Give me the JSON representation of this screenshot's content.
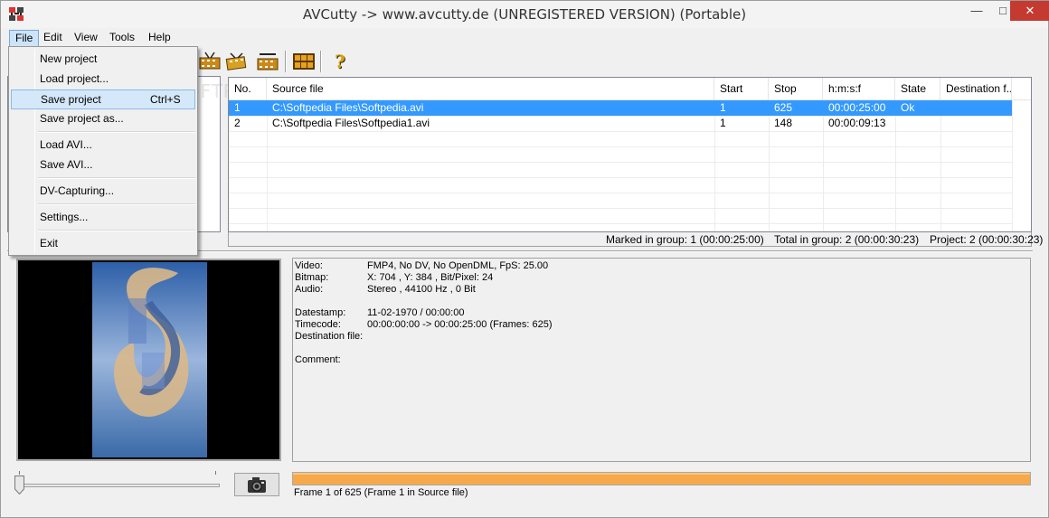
{
  "window": {
    "title": "AVCutty -> www.avcutty.de (UNREGISTERED VERSION) (Portable)",
    "minimize_glyph": "—",
    "maximize_glyph": "□",
    "close_glyph": "✕"
  },
  "menubar": {
    "items": [
      "File",
      "Edit",
      "View",
      "Tools",
      "Help"
    ]
  },
  "file_menu": {
    "items": [
      {
        "label": "New project",
        "shortcut": ""
      },
      {
        "label": "Load project...",
        "shortcut": ""
      },
      {
        "label": "Save project",
        "shortcut": "Ctrl+S"
      },
      {
        "label": "Save project as...",
        "shortcut": ""
      },
      {
        "label": "Load AVI...",
        "shortcut": ""
      },
      {
        "label": "Save AVI...",
        "shortcut": ""
      },
      {
        "label": "DV-Capturing...",
        "shortcut": ""
      },
      {
        "label": "Settings...",
        "shortcut": ""
      },
      {
        "label": "Exit",
        "shortcut": ""
      }
    ],
    "highlighted": "Save project"
  },
  "toolbar": {
    "icons": [
      "film-cut-icon",
      "film-cut-forward-icon",
      "film-clapper-icon",
      "grid-view-icon",
      "help-icon"
    ],
    "help_glyph": "?"
  },
  "listview": {
    "columns": [
      "No.",
      "Source file",
      "Start",
      "Stop",
      "h:m:s:f",
      "State",
      "Destination f..."
    ],
    "rows": [
      {
        "no": "1",
        "source": "C:\\Softpedia Files\\Softpedia.avi",
        "start": "1",
        "stop": "625",
        "hmsf": "00:00:25:00",
        "state": "Ok",
        "dest": "",
        "selected": true
      },
      {
        "no": "2",
        "source": "C:\\Softpedia Files\\Softpedia1.avi",
        "start": "1",
        "stop": "148",
        "hmsf": "00:00:09:13",
        "state": "",
        "dest": "",
        "selected": false
      }
    ]
  },
  "list_status": {
    "marked": "Marked in group: 1 (00:00:25:00)",
    "total": "Total in group: 2 (00:00:30:23)",
    "project": "Project: 2 (00:00:30:23)"
  },
  "info": {
    "video_label": "Video:",
    "video_value": "FMP4, No DV, No OpenDML, FpS: 25.00",
    "bitmap_label": "Bitmap:",
    "bitmap_value": "X: 704 , Y: 384 , Bit/Pixel: 24",
    "audio_label": "Audio:",
    "audio_value": "Stereo , 44100 Hz , 0 Bit",
    "datestamp_label": "Datestamp:",
    "datestamp_value": "11-02-1970 / 00:00:00",
    "timecode_label": "Timecode:",
    "timecode_value": "00:00:00:00 -> 00:00:25:00 (Frames: 625)",
    "destination_label": "Destination file:",
    "destination_value": "",
    "comment_label": "Comment:",
    "comment_value": ""
  },
  "progress": {
    "fraction": 1.0,
    "color": "#f6a94a"
  },
  "frame_status": "Frame 1 of 625 (Frame 1 in Source file)",
  "slider": {
    "position_fraction": 0.0
  },
  "colors": {
    "selection": "#3399ff",
    "menu_highlight": "#d5e8fa"
  }
}
